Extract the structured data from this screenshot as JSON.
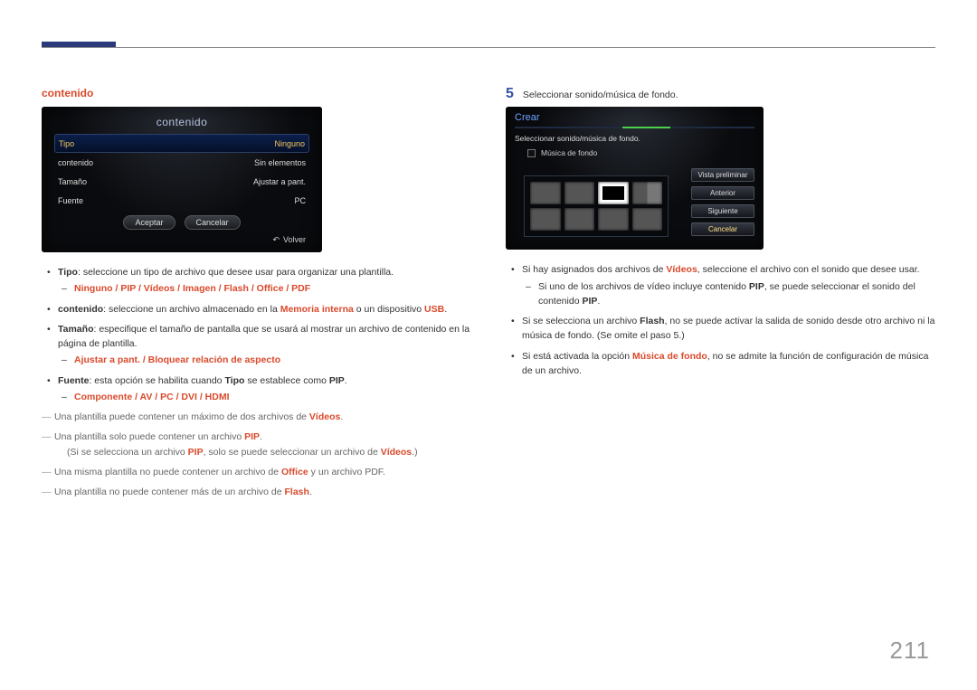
{
  "page": {
    "number": "211"
  },
  "left": {
    "section_title": "contenido",
    "panel": {
      "title": "contenido",
      "rows": [
        {
          "label": "Tipo",
          "value": "Ninguno",
          "selected": true
        },
        {
          "label": "contenido",
          "value": "Sin elementos",
          "selected": false
        },
        {
          "label": "Tamaño",
          "value": "Ajustar a pant.",
          "selected": false
        },
        {
          "label": "Fuente",
          "value": "PC",
          "selected": false
        }
      ],
      "buttons": {
        "accept": "Aceptar",
        "cancel": "Cancelar"
      },
      "footer": "Volver"
    },
    "bullets": {
      "tipo_lead": "Tipo",
      "tipo_rest": ": seleccione un tipo de archivo que desee usar para organizar una plantilla.",
      "tipo_options": "Ninguno / PIP / Vídeos / Imagen / Flash / Office / PDF",
      "contenido_lead": "contenido",
      "contenido_mid": ": seleccione un archivo almacenado en la ",
      "contenido_mem": "Memoria interna",
      "contenido_mid2": " o un dispositivo ",
      "contenido_usb": "USB",
      "contenido_end": ".",
      "tamano_lead": "Tamaño",
      "tamano_rest": ": especifique el tamaño de pantalla que se usará al mostrar un archivo de contenido en la página de plantilla.",
      "tamano_options": "Ajustar a pant. / Bloquear relación de aspecto",
      "fuente_lead": "Fuente",
      "fuente_mid1": ": esta opción se habilita cuando ",
      "fuente_tipo": "Tipo",
      "fuente_mid2": " se establece como ",
      "fuente_pip": "PIP",
      "fuente_end": ".",
      "fuente_options": "Componente / AV / PC / DVI / HDMI"
    },
    "dashes": {
      "d1a": "Una plantilla puede contener un máximo de dos archivos de ",
      "d1b": "Vídeos",
      "d1c": ".",
      "d2a": "Una plantilla solo puede contener un archivo ",
      "d2b": "PIP",
      "d2c": ".",
      "d2sub_a": "(Si se selecciona un archivo ",
      "d2sub_b": "PIP",
      "d2sub_c": ", solo se puede seleccionar un archivo de ",
      "d2sub_d": "Vídeos",
      "d2sub_e": ".)",
      "d3a": "Una misma plantilla no puede contener un archivo de ",
      "d3b": "Office",
      "d3c": " y un archivo PDF.",
      "d4a": "Una plantilla no puede contener más de un archivo de ",
      "d4b": "Flash",
      "d4c": "."
    }
  },
  "right": {
    "step": {
      "num": "5",
      "text": "Seleccionar sonido/música de fondo."
    },
    "panel": {
      "title": "Crear",
      "subtitle": "Seleccionar sonido/música de fondo.",
      "checkbox_label": "Música de fondo",
      "side_buttons": {
        "preview": "Vista preliminar",
        "prev": "Anterior",
        "next": "Siguiente",
        "cancel": "Cancelar"
      }
    },
    "bullets": {
      "b1a": "Si hay asignados dos archivos de ",
      "b1b": "Vídeos",
      "b1c": ", seleccione el archivo con el sonido que desee usar.",
      "b1sub_a": "Si uno de los archivos de vídeo incluye contenido ",
      "b1sub_b": "PIP",
      "b1sub_c": ", se puede seleccionar el sonido del contenido ",
      "b1sub_d": "PIP",
      "b1sub_e": ".",
      "b2a": "Si se selecciona un archivo ",
      "b2b": "Flash",
      "b2c": ", no se puede activar la salida de sonido desde otro archivo ni la música de fondo. (Se omite el paso 5.)",
      "b3a": "Si está activada la opción ",
      "b3b": "Música de fondo",
      "b3c": ", no se admite la función de configuración de música de un archivo."
    }
  }
}
